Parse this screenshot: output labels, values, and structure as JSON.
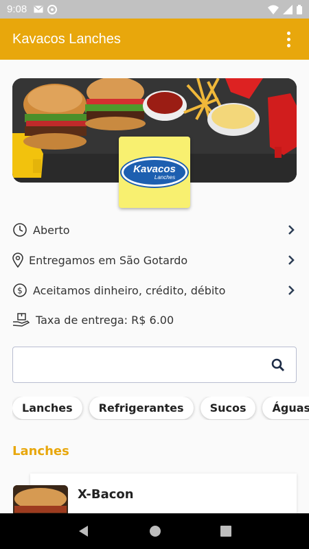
{
  "status_bar": {
    "time": "9:08"
  },
  "app_bar": {
    "title": "Kavacos Lanches"
  },
  "logo": {
    "line1": "Kavacos",
    "line2": "Lanches"
  },
  "info": {
    "status": "Aberto",
    "delivery_area": "Entregamos em São Gotardo",
    "payment": "Aceitamos dinheiro, crédito, débito",
    "delivery_fee": "Taxa de entrega: R$ 6.00"
  },
  "search": {
    "placeholder": ""
  },
  "categories": [
    "Lanches",
    "Refrigerantes",
    "Sucos",
    "Águas"
  ],
  "section": {
    "title": "Lanches"
  },
  "items": [
    {
      "name": "X-Bacon"
    }
  ],
  "colors": {
    "accent": "#e8a70c",
    "status_bar": "#c1c1c1"
  }
}
